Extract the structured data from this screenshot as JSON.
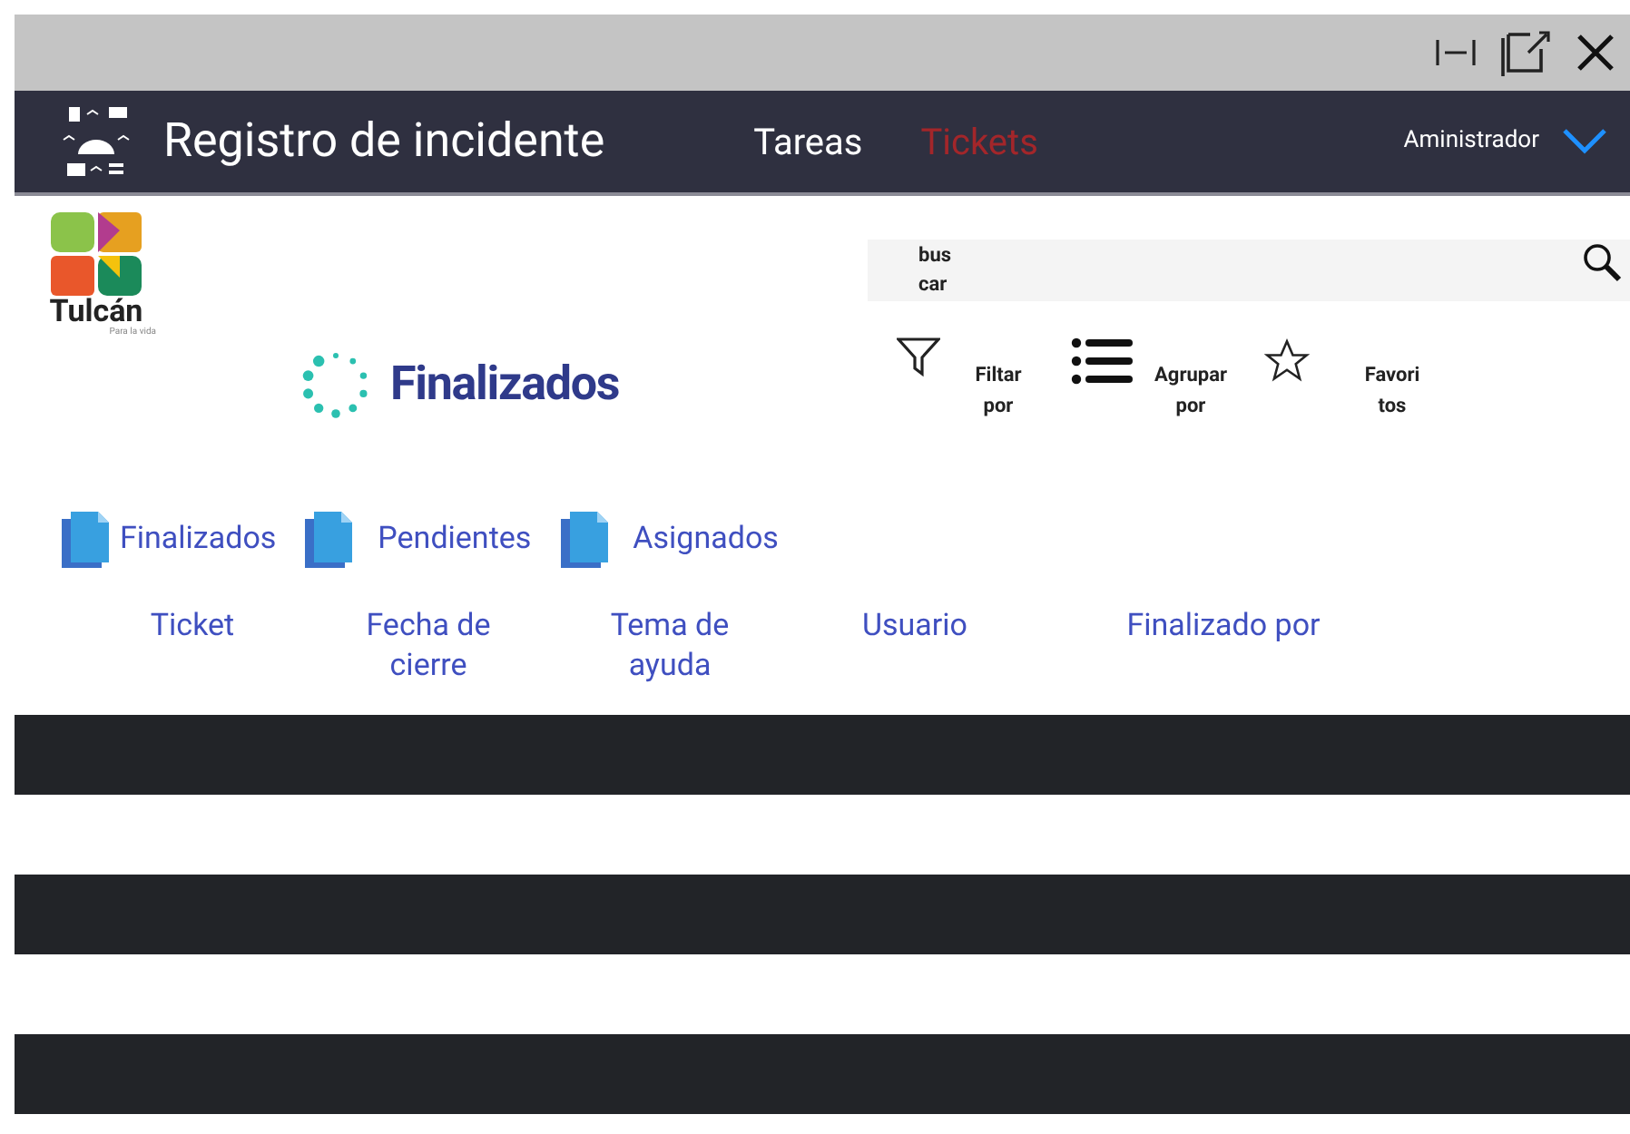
{
  "app_bar": {
    "title": "Registro de incidente",
    "nav": [
      {
        "label": "Tareas",
        "selected": false
      },
      {
        "label": "Tickets",
        "selected": true
      }
    ],
    "user": "Aministrador"
  },
  "logo": {
    "name": "Tulcán",
    "tagline": "Para la vida"
  },
  "search": {
    "placeholder": "bus car"
  },
  "toolbar": [
    {
      "kind": "filter",
      "label": "Filtar por"
    },
    {
      "kind": "group",
      "label": "Agrupar por"
    },
    {
      "kind": "favorite",
      "label": "Favori tos"
    }
  ],
  "heading": "Finalizados",
  "folders": [
    "Finalizados",
    "Pendientes",
    "Asignados"
  ],
  "table": {
    "columns": [
      "Ticket",
      "Fecha de cierre",
      "Tema de ayuda",
      "Usuario",
      "Finalizado por"
    ],
    "rows": [
      {
        "shaded": true
      },
      {
        "shaded": false
      },
      {
        "shaded": true
      },
      {
        "shaded": false
      },
      {
        "shaded": true
      }
    ]
  }
}
